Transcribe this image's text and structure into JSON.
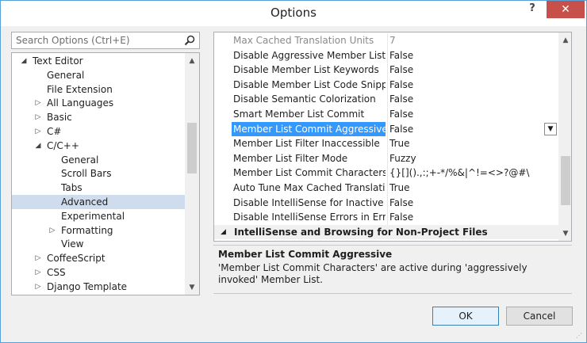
{
  "window": {
    "title": "Options",
    "help_glyph": "?",
    "close_glyph": "✕"
  },
  "search": {
    "placeholder": "Search Options (Ctrl+E)"
  },
  "tree": {
    "items": [
      {
        "label": "Text Editor",
        "level": 1,
        "arrow": "◢"
      },
      {
        "label": "General",
        "level": 2,
        "arrow": ""
      },
      {
        "label": "File Extension",
        "level": 2,
        "arrow": ""
      },
      {
        "label": "All Languages",
        "level": 2,
        "arrow": "▷"
      },
      {
        "label": "Basic",
        "level": 2,
        "arrow": "▷"
      },
      {
        "label": "C#",
        "level": 2,
        "arrow": "▷"
      },
      {
        "label": "C/C++",
        "level": 2,
        "arrow": "◢"
      },
      {
        "label": "General",
        "level": 3,
        "arrow": ""
      },
      {
        "label": "Scroll Bars",
        "level": 3,
        "arrow": ""
      },
      {
        "label": "Tabs",
        "level": 3,
        "arrow": ""
      },
      {
        "label": "Advanced",
        "level": 3,
        "arrow": "",
        "selected": true
      },
      {
        "label": "Experimental",
        "level": 3,
        "arrow": ""
      },
      {
        "label": "Formatting",
        "level": 3,
        "arrow": "▷"
      },
      {
        "label": "View",
        "level": 3,
        "arrow": ""
      },
      {
        "label": "CoffeeScript",
        "level": 2,
        "arrow": "▷"
      },
      {
        "label": "CSS",
        "level": 2,
        "arrow": "▷"
      },
      {
        "label": "Django Template",
        "level": 2,
        "arrow": "▷"
      }
    ]
  },
  "grid": {
    "rows": [
      {
        "name": "Max Cached Translation Units",
        "value": "7",
        "faded": true
      },
      {
        "name": "Disable Aggressive Member List",
        "value": "False"
      },
      {
        "name": "Disable Member List Keywords",
        "value": "False"
      },
      {
        "name": "Disable Member List Code Snippets",
        "value": "False"
      },
      {
        "name": "Disable Semantic Colorization",
        "value": "False"
      },
      {
        "name": "Smart Member List Commit",
        "value": "False"
      },
      {
        "name": "Member List Commit Aggressive",
        "value": "False",
        "selected": true
      },
      {
        "name": "Member List Filter Inaccessible",
        "value": "True"
      },
      {
        "name": "Member List Filter Mode",
        "value": "Fuzzy"
      },
      {
        "name": "Member List Commit Characters",
        "value": "{}[]().,:;+-*/%&|^!=<>?@#\\"
      },
      {
        "name": "Auto Tune Max Cached Translation U",
        "value": "True"
      },
      {
        "name": "Disable IntelliSense for Inactive Share",
        "value": "False"
      },
      {
        "name": "Disable IntelliSense Errors in Error List",
        "value": "False"
      }
    ],
    "category": "IntelliSense and Browsing for Non-Project Files"
  },
  "description": {
    "title": "Member List Commit Aggressive",
    "text": "'Member List Commit Characters' are active during 'aggressively invoked' Member List."
  },
  "buttons": {
    "ok": "OK",
    "cancel": "Cancel"
  },
  "colors": {
    "selection": "#3399ff",
    "tree_selection": "#cfdcee",
    "close": "#c7504a"
  }
}
